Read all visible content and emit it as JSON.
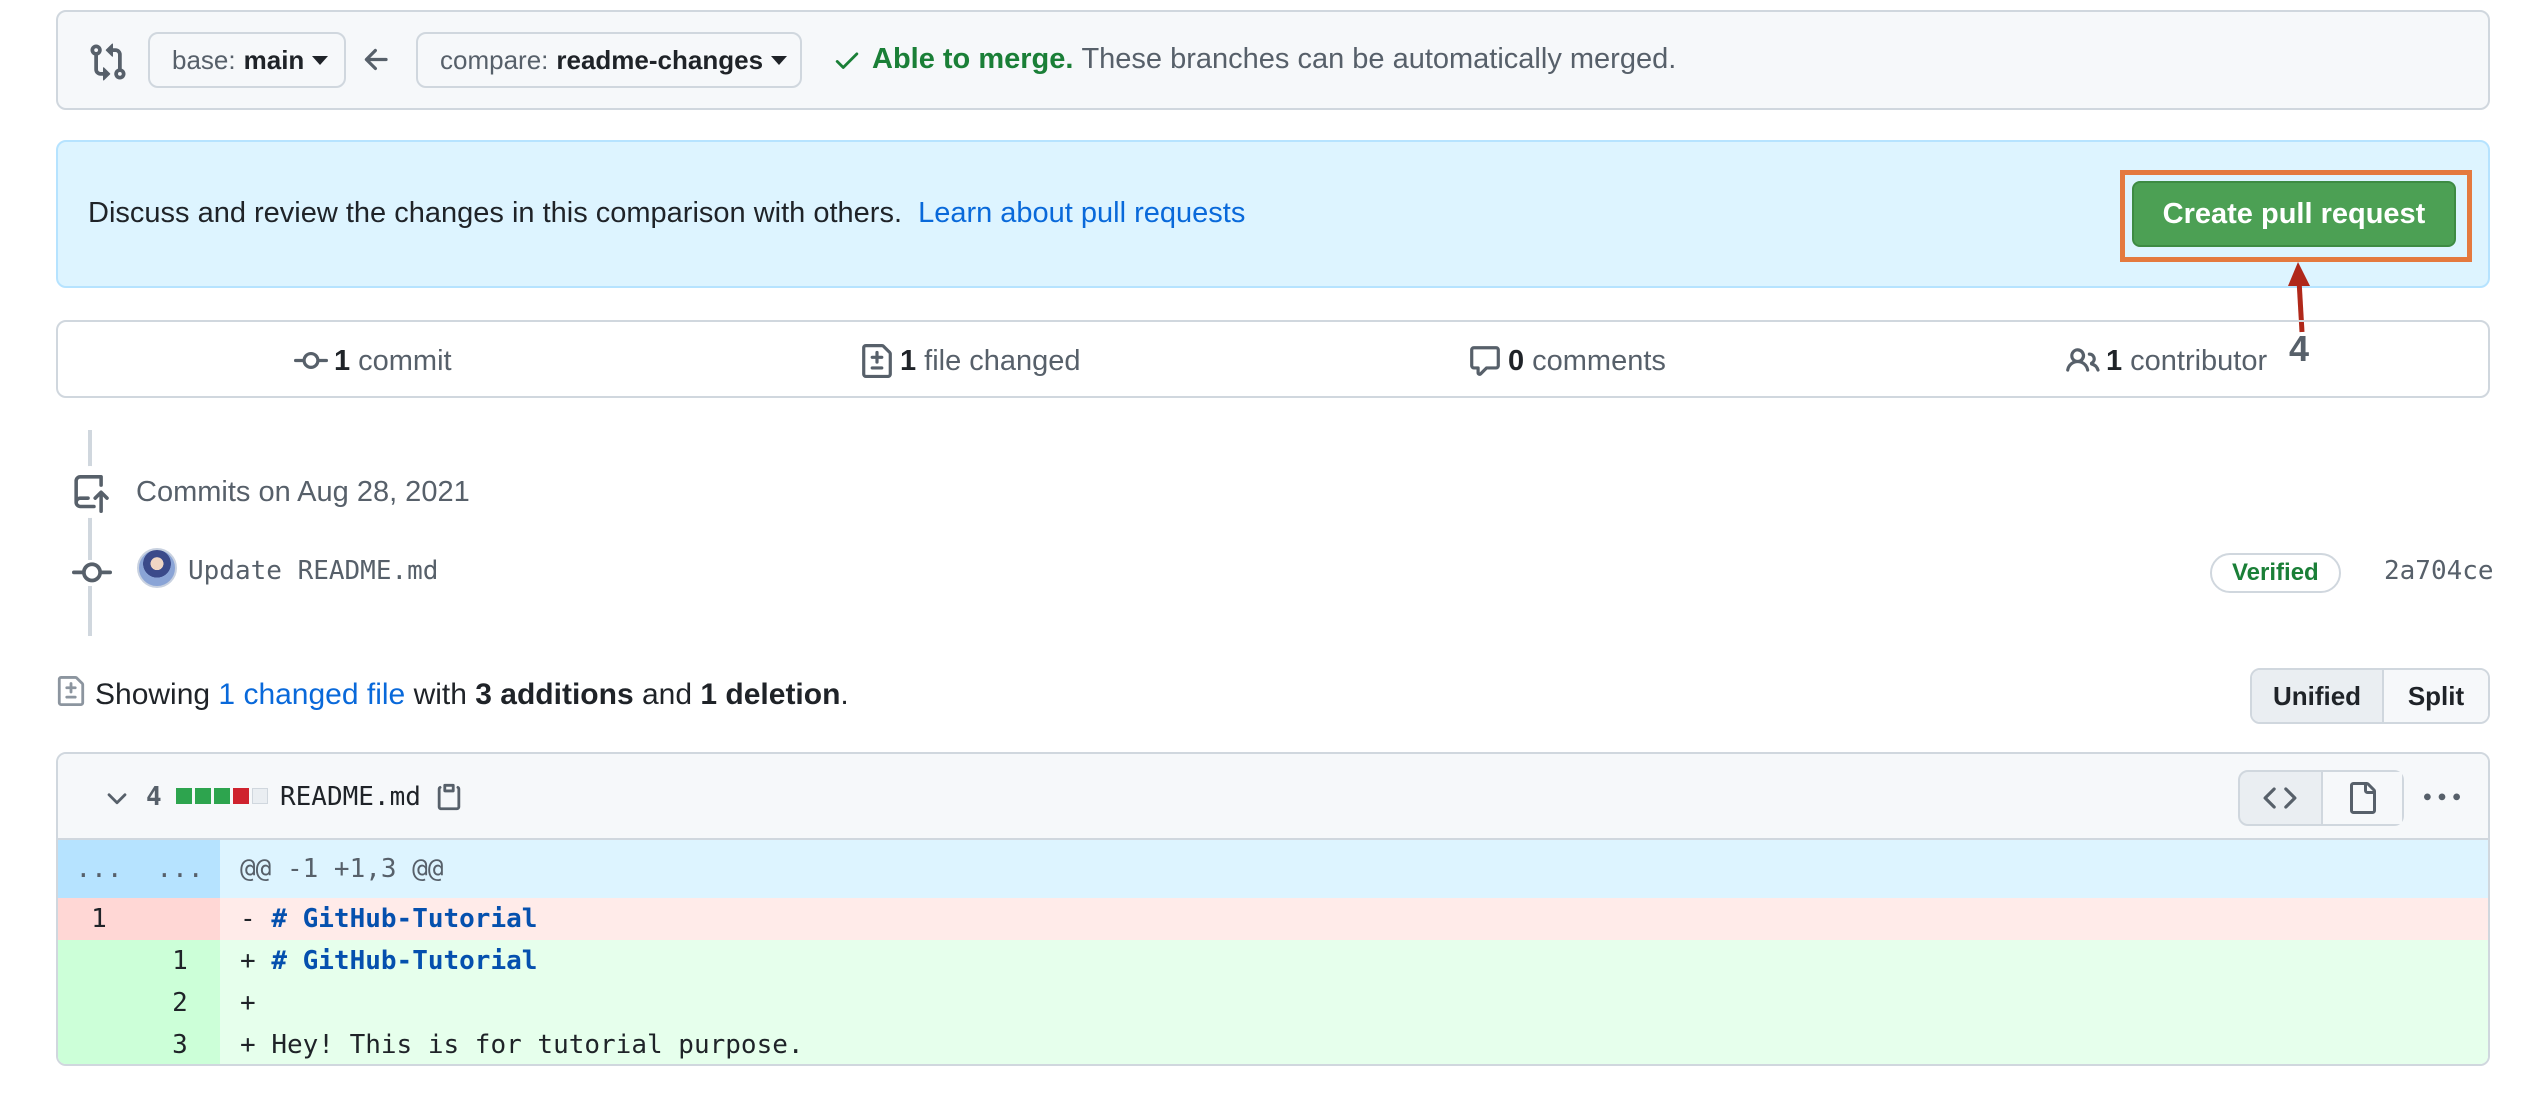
{
  "compare": {
    "base_prefix": "base:",
    "base_branch": "main",
    "compare_prefix": "compare:",
    "compare_branch": "readme-changes",
    "merge_ok": "Able to merge.",
    "merge_msg": "These branches can be automatically merged."
  },
  "banner": {
    "text": "Discuss and review the changes in this comparison with others.",
    "link": "Learn about pull requests",
    "button": "Create pull request",
    "callout_number": "4"
  },
  "summary": {
    "commits_count": "1",
    "commits_label": "commit",
    "files_count": "1",
    "files_label": "file changed",
    "comments_count": "0",
    "comments_label": "comments",
    "contributors_count": "1",
    "contributors_label": "contributor"
  },
  "commits": {
    "header": "Commits on Aug 28, 2021",
    "items": [
      {
        "message": "Update README.md",
        "badge": "Verified",
        "sha": "2a704ce"
      }
    ]
  },
  "files_summary": {
    "prefix": "Showing",
    "changed_link": "1 changed file",
    "with": "with",
    "additions": "3 additions",
    "and": "and",
    "deletions": "1 deletion",
    "suffix": "."
  },
  "view_toggle": {
    "unified": "Unified",
    "split": "Split",
    "selected": "Unified"
  },
  "diff": {
    "count": "4",
    "file": "README.md",
    "diffstat": [
      "added",
      "added",
      "added",
      "deleted",
      "neutral"
    ],
    "hunk_left": "...",
    "hunk_right": "...",
    "hunk": "@@ -1 +1,3 @@",
    "lines": [
      {
        "type": "del",
        "old": "1",
        "new": "",
        "sign": "-",
        "text": "# GitHub-Tutorial"
      },
      {
        "type": "add",
        "old": "",
        "new": "1",
        "sign": "+",
        "text": "# GitHub-Tutorial"
      },
      {
        "type": "add",
        "old": "",
        "new": "2",
        "sign": "+",
        "text": ""
      },
      {
        "type": "add",
        "old": "",
        "new": "3",
        "sign": "+",
        "text": "Hey! This is for tutorial purpose."
      }
    ]
  },
  "colors": {
    "accent_green": "#4ca054",
    "link_blue": "#0969da",
    "callout_orange": "#e4793f",
    "callout_arrow": "#b0281a"
  },
  "icons": [
    "git-compare-icon",
    "arrow-left-icon",
    "check-icon",
    "commit-icon",
    "file-diff-icon",
    "comment-icon",
    "people-icon",
    "repo-push-icon",
    "chevron-down-icon",
    "copy-icon",
    "code-icon",
    "file-icon",
    "kebab-icon"
  ]
}
